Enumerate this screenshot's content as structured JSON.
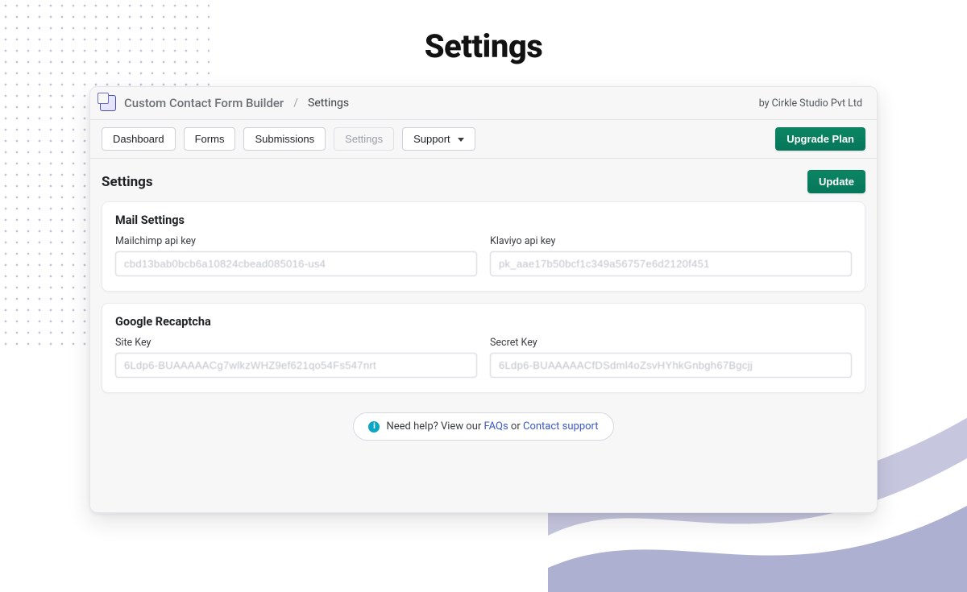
{
  "page": {
    "title": "Settings"
  },
  "header": {
    "app_name": "Custom Contact Form Builder",
    "breadcrumb_sep": "/",
    "breadcrumb_current": "Settings",
    "byline": "by Cirkle Studio Pvt Ltd"
  },
  "tabs": {
    "dashboard": "Dashboard",
    "forms": "Forms",
    "submissions": "Submissions",
    "settings": "Settings",
    "support": "Support",
    "upgrade": "Upgrade Plan"
  },
  "section": {
    "title": "Settings",
    "update": "Update"
  },
  "mail_card": {
    "title": "Mail Settings",
    "mailchimp_label": "Mailchimp api key",
    "mailchimp_value": "cbd13bab0bcb6a10824cbead085016-us4",
    "klaviyo_label": "Klaviyo api key",
    "klaviyo_value": "pk_aae17b50bcf1c349a56757e6d2120f451"
  },
  "recaptcha_card": {
    "title": "Google Recaptcha",
    "site_key_label": "Site Key",
    "site_key_value": "6Ldp6-BUAAAAACg7wlkzWHZ9ef621qo54Fs547nrt",
    "secret_key_label": "Secret Key",
    "secret_key_value": "6Ldp6-BUAAAAACfDSdml4oZsvHYhkGnbgh67Bgcjj"
  },
  "help": {
    "prefix": "Need help? View our ",
    "faqs": "FAQs",
    "middle": " or ",
    "contact": "Contact support"
  }
}
